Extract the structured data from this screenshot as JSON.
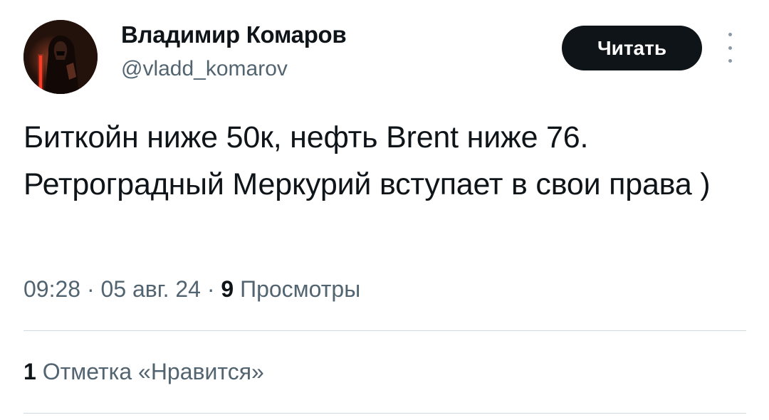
{
  "author": {
    "display_name": "Владимир Комаров",
    "handle": "@vladd_komarov"
  },
  "actions": {
    "follow_label": "Читать",
    "more_icon": "more-vertical-icon"
  },
  "tweet": {
    "text": "Биткойн ниже 50к, нефть Brent ниже 76. Ретроградный Меркурий вступает в свои права )",
    "time": "09:28",
    "date": "05 авг. 24",
    "separator": "·",
    "views_count": "9",
    "views_label": "Просмотры"
  },
  "stats": {
    "likes_count": "1",
    "likes_label": "Отметка «Нравится»"
  },
  "colors": {
    "text_primary": "#0f1419",
    "text_secondary": "#536471",
    "button_bg": "#0f1419",
    "divider": "#cfd9de"
  }
}
